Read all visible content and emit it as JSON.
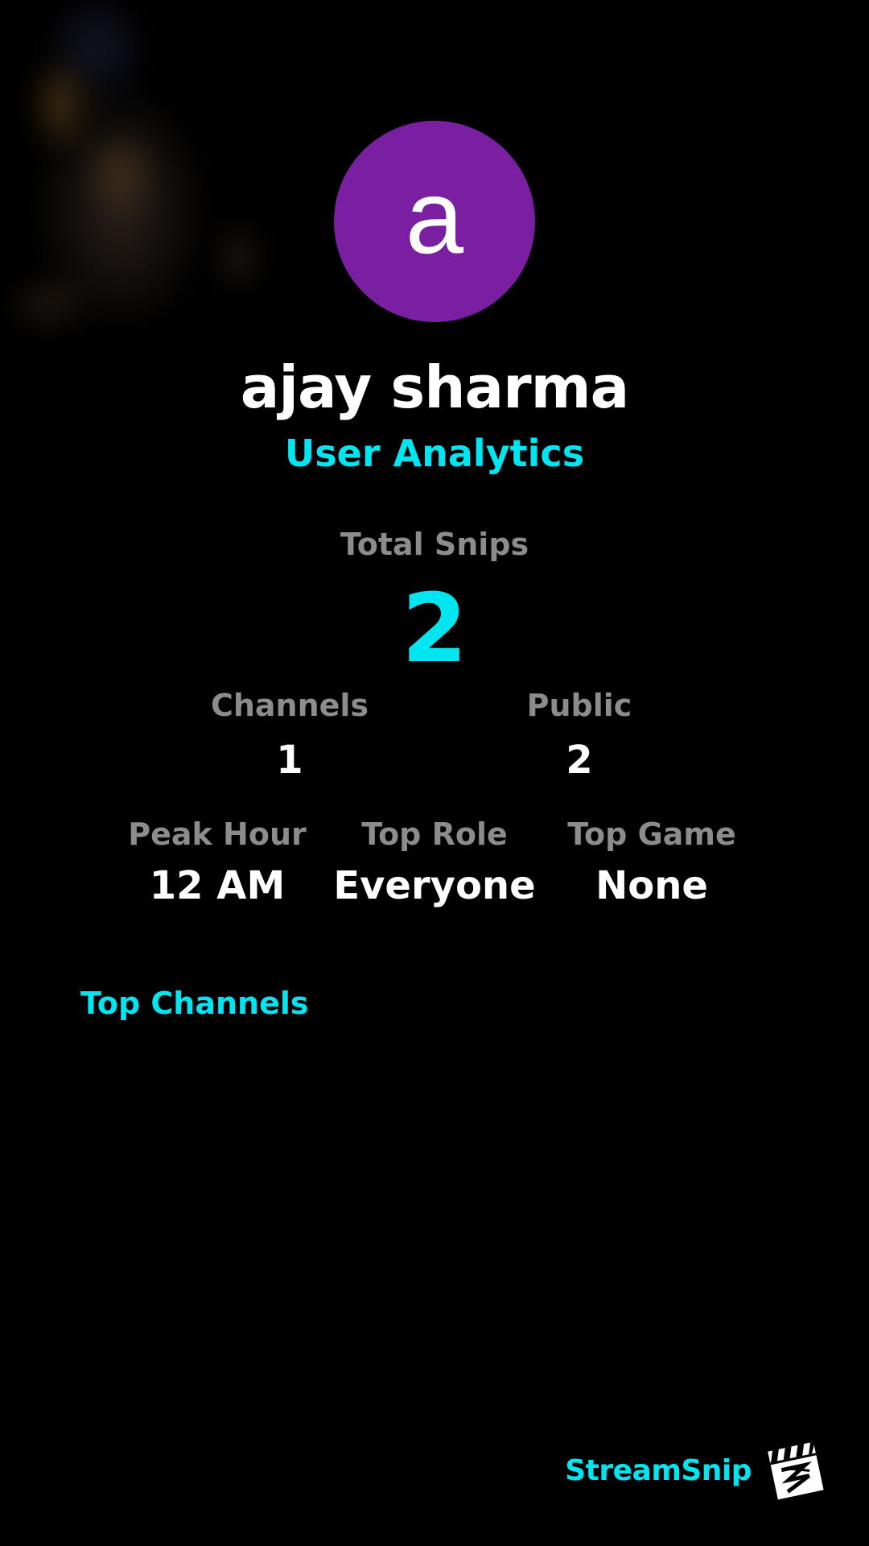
{
  "colors": {
    "accent": "#00e5f0",
    "avatar_bg": "#7b1fa2",
    "muted": "#8c8c8c",
    "background": "#000000",
    "text": "#ffffff"
  },
  "profile": {
    "avatar_initial": "a",
    "name": "ajay sharma",
    "subtitle": "User Analytics"
  },
  "stats": {
    "total_snips": {
      "label": "Total Snips",
      "value": "2"
    },
    "channels": {
      "label": "Channels",
      "value": "1"
    },
    "public": {
      "label": "Public",
      "value": "2"
    },
    "peak_hour": {
      "label": "Peak Hour",
      "value": "12 AM"
    },
    "top_role": {
      "label": "Top Role",
      "value": "Everyone"
    },
    "top_game": {
      "label": "Top Game",
      "value": "None"
    }
  },
  "sections": {
    "top_channels_title": "Top Channels"
  },
  "branding": {
    "name": "StreamSnip",
    "logo_icon": "clapperboard-logo-icon"
  }
}
